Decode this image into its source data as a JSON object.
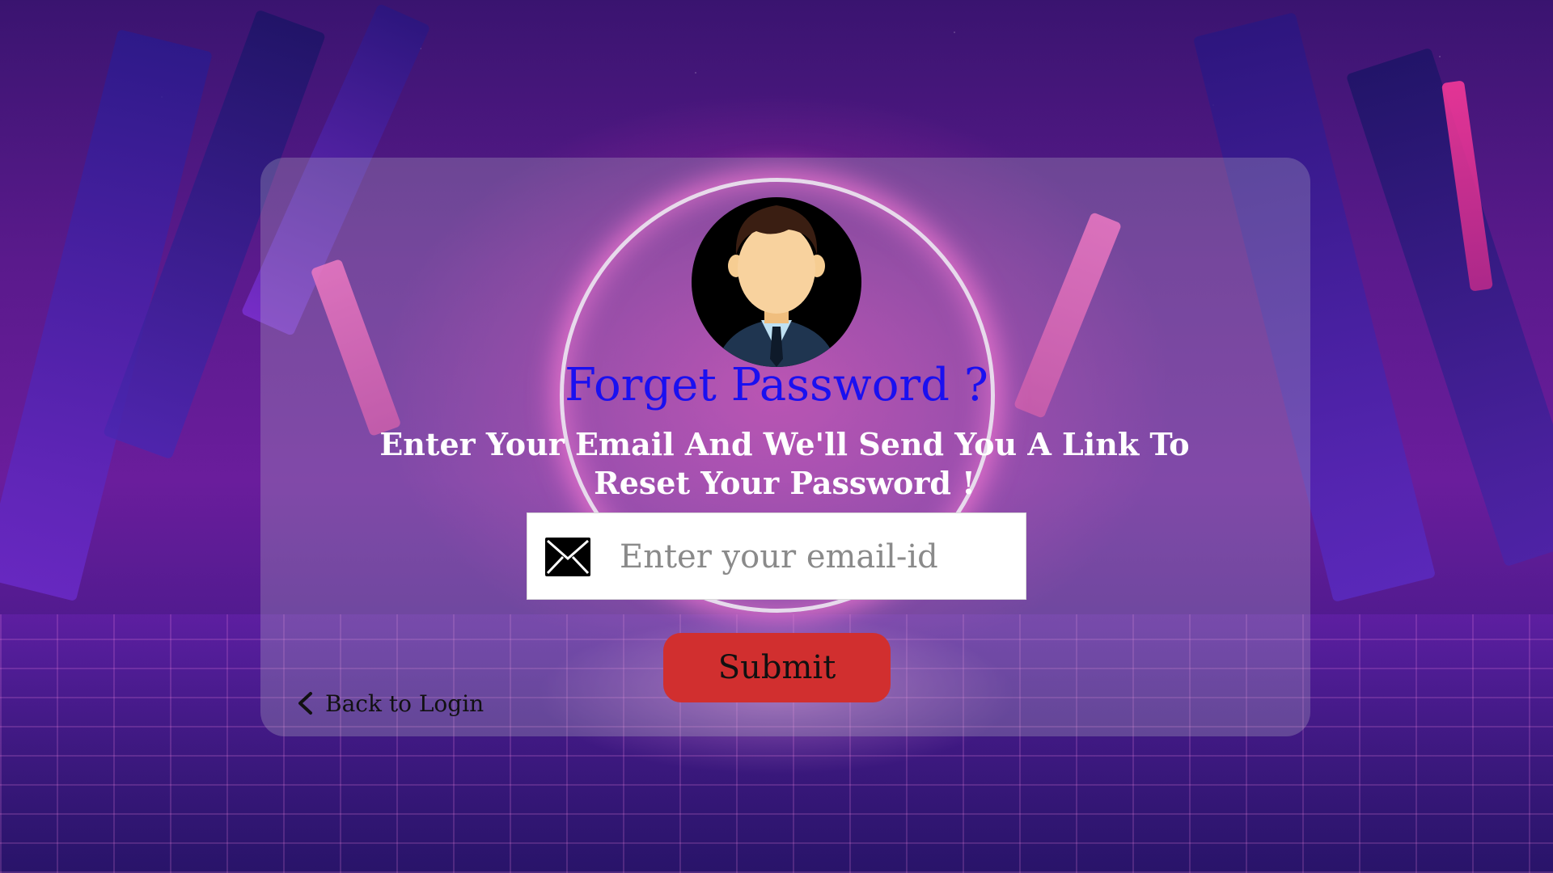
{
  "page": {
    "title": "Forget Password ?",
    "subtitle": "Enter Your Email And We'll Send You A Link To Reset Your Password !"
  },
  "form": {
    "email_placeholder": "Enter your email-id",
    "email_value": "",
    "submit_label": "Submit",
    "back_label": "Back to Login"
  },
  "icons": {
    "avatar": "user-avatar-icon",
    "mail": "envelope-icon",
    "back": "chevron-left-icon"
  },
  "colors": {
    "title": "#1a10f0",
    "subtitle": "#ffffff",
    "submit_bg": "#d12f2f",
    "card_bg": "rgba(190,190,200,0.28)"
  }
}
